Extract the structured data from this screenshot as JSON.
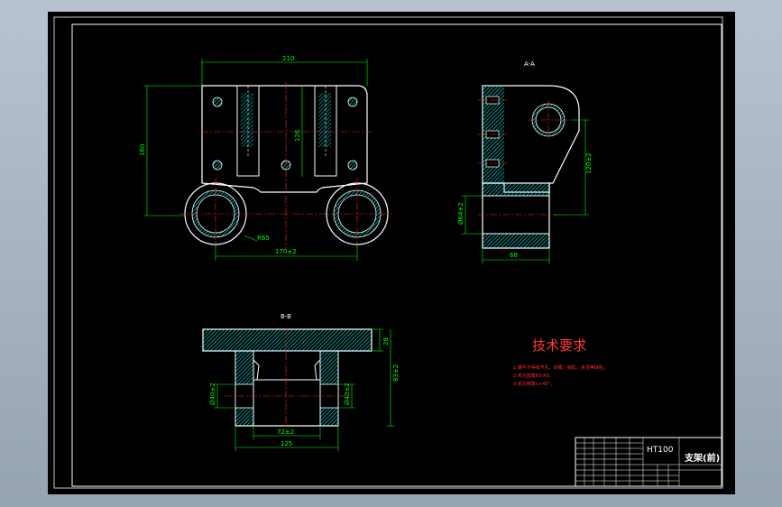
{
  "drawing": {
    "front_view": {
      "width_dim": "210",
      "height_dim": "160",
      "inner_dim": "126",
      "hole_spacing_dim": "170±2",
      "radius_dim": "R65"
    },
    "side_view": {
      "section_label": "A-A",
      "height_dim": "120±2",
      "bore_dim": "Ø64±2",
      "width_dim": "68"
    },
    "bottom_view": {
      "section_label": "B-B",
      "flange_dim": "28",
      "height_dim": "83±2",
      "bore_dim": "Ø40±2",
      "inner_width_dim": "72±2",
      "outer_width_dim": "125"
    },
    "tech_requirements": {
      "title": "技术要求",
      "lines": [
        "1.铸件不得有气孔、砂眼、缩松、夹渣等缺陷。",
        "2.未注圆角R3-R5。",
        "3.未注倒角1×45°。"
      ]
    },
    "title_block": {
      "material": "HT100",
      "part_name": "支架(前)"
    }
  },
  "colors": {
    "background": "#000000",
    "outline": "#ffffff",
    "dimension": "#00ff00",
    "centerline": "#ff0000",
    "hatch": "#00ffff",
    "border": "#a0a0a0"
  }
}
